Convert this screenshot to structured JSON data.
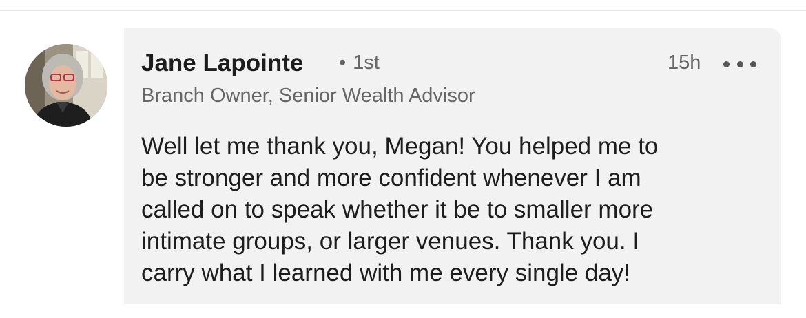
{
  "comment": {
    "author": {
      "name": "Jane Lapointe",
      "degree": "1st",
      "degree_separator": "•",
      "headline": "Branch Owner, Senior Wealth Advisor"
    },
    "timestamp": "15h",
    "more_icon": "more-horizontal-icon",
    "text": "Well let me thank you, Megan!  You helped me to\nbe stronger and more confident whenever I am\ncalled on to speak whether it be to smaller more\nintimate groups, or larger venues.  Thank you.  I\ncarry what I learned with me every single day!"
  },
  "colors": {
    "bubble_background": "#f2f2f2",
    "primary_text": "#1d1d1d",
    "secondary_text": "#666666"
  }
}
